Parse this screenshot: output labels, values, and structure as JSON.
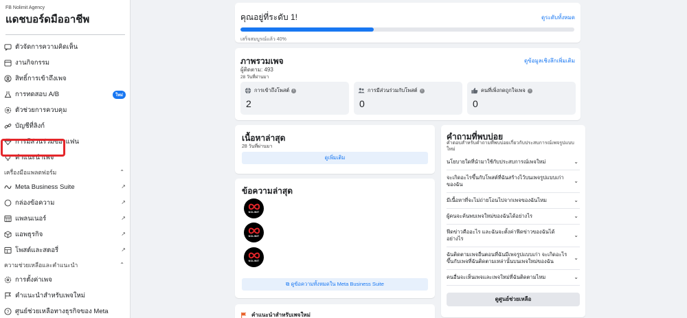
{
  "sidebar": {
    "agency": "FB Nolimit Agency",
    "title": "แดชบอร์ดมืออาชีพ",
    "items": [
      {
        "label": "ตัวจัดการความคิดเห็น",
        "icon": "comment-manager-icon"
      },
      {
        "label": "งานกิจกรรม",
        "icon": "calendar-icon"
      },
      {
        "label": "สิทธิ์การเข้าถึงเพจ",
        "icon": "access-icon"
      },
      {
        "label": "การทดสอบ A/B",
        "icon": "flask-icon",
        "badge": "ใหม่"
      },
      {
        "label": "ตัวช่วยการควบคุม",
        "icon": "gear-icon"
      },
      {
        "label": "บัญชีที่ลิงก์",
        "icon": "link-icon"
      },
      {
        "label": "การมีส่วนร่วมของแฟน",
        "icon": "diamond-icon"
      },
      {
        "label": "คำแนะนำเพจ",
        "icon": "lightbulb-icon"
      }
    ],
    "section_tools": "เครื่องมือแพลตฟอร์ม",
    "tools": [
      {
        "label": "Meta Business Suite",
        "icon": "meta-icon"
      },
      {
        "label": "กล่องข้อความ",
        "icon": "chat-icon"
      },
      {
        "label": "แพลนเนอร์",
        "icon": "grid-calendar-icon"
      },
      {
        "label": "แอพธุรกิจ",
        "icon": "cube-icon"
      },
      {
        "label": "โพสต์และสตอรี่",
        "icon": "posts-icon"
      }
    ],
    "section_help": "ความช่วยเหลือและคำแนะนำ",
    "help": [
      {
        "label": "การตั้งค่าเพจ",
        "icon": "gear-icon"
      },
      {
        "label": "คำแนะนำสำหรับเพจใหม่",
        "icon": "flag-icon"
      },
      {
        "label": "ศูนย์ช่วยเหลือทางธุรกิจของ Meta",
        "icon": "help-icon"
      }
    ]
  },
  "progress": {
    "title": "คุณอยู่ที่ระดับ 1!",
    "link": "ดูระดับทั้งหมด",
    "status": "เสร็จสมบูรณ์แล้ว 40%",
    "percent": 40,
    "color": "#1877f2"
  },
  "overview": {
    "title": "ภาพรวมเพจ",
    "link": "ดูข้อมูลเชิงลึกเพิ่มเติม",
    "followers": "ผู้ติดตาม: 493",
    "days": "28 วันที่ผ่านมา",
    "metrics": [
      {
        "label": "การเข้าถึงโพสต์",
        "value": "2",
        "icon": "globe-icon"
      },
      {
        "label": "การมีส่วนร่วมกับโพสต์",
        "value": "0",
        "icon": "people-icon"
      },
      {
        "label": "คนที่เพิ่งกดถูกใจเพจ",
        "value": "0",
        "icon": "thumbs-up-icon"
      }
    ]
  },
  "latest_content": {
    "title": "เนื้อหาล่าสุด",
    "days": "28 วันที่ผ่านมา",
    "button": "ดูเพิ่มเติม"
  },
  "latest_messages": {
    "title": "ข้อความล่าสุด",
    "avatar_text": "NOLIMIT",
    "button": "ดูข้อความทั้งหมดใน Meta Business Suite"
  },
  "recommendation": {
    "title": "คำแนะนำสำหรับเพจใหม่"
  },
  "faq": {
    "title": "คำถามที่พบบ่อย",
    "subtitle": "คำตอบสำหรับคำถามที่พบบ่อยเกี่ยวกับประสบการณ์เพจรูปแบบใหม่",
    "items": [
      "นโยบายใดที่นำมาใช้กับประสบการณ์เพจใหม่",
      "จะเกิดอะไรขึ้นกับโพสต์ที่ฉันสร้างไว้บนเพจรูปแบบเก่าของฉัน",
      "มีเนื้อหาที่จะไม่ถ่ายโอนไปจากเพจของฉันไหม",
      "ผู้คนจะค้นพบเพจใหม่ของฉันได้อย่างไร",
      "ฟีดข่าวคืออะไร และฉันจะตั้งค่าฟีดข่าวของฉันได้อย่างไร",
      "ฉันติดตามเพจอื่นตอนที่ฉันมีเพจรูปแบบเก่า จะเกิดอะไรขึ้นกับเพจที่ฉันติดตามเหล่านั้นบนเพจใหม่ของฉัน",
      "คนอื่นจะเห็นเพจและเพจใหม่ที่ฉันติดตามไหม"
    ],
    "button": "ดูศูนย์ช่วยเหลือ"
  }
}
